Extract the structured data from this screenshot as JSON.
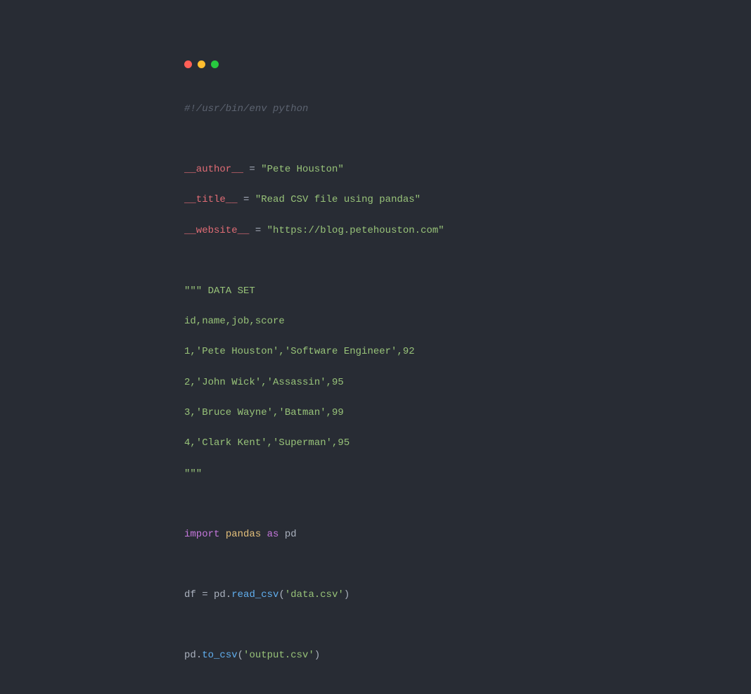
{
  "windowControls": {
    "closeColor": "#ff5f56",
    "minimizeColor": "#ffbd2e",
    "zoomColor": "#27c93f"
  },
  "code": {
    "shebang": "#!/usr/bin/env python",
    "authorKey": "__author__",
    "authorVal": "\"Pete Houston\"",
    "titleKey": "__title__",
    "titleVal": "\"Read CSV file using pandas\"",
    "websiteKey": "__website__",
    "websiteVal": "\"https://blog.petehouston.com\"",
    "eq": " = ",
    "docOpen": "\"\"\" DATA SET",
    "csvHeader": "id,name,job,score",
    "row1": "1,'Pete Houston','Software Engineer',92",
    "row2": "2,'John Wick','Assassin',95",
    "row3": "3,'Bruce Wayne','Batman',99",
    "row4": "4,'Clark Kent','Superman',95",
    "docClose": "\"\"\"",
    "importKw": "import",
    "importModule": " pandas ",
    "asKw": "as",
    "importAlias": " pd",
    "dfVar": "df",
    "eq2": " = ",
    "pdRef1": "pd",
    "dot": ".",
    "readCsv": "read_csv",
    "readArg": "'data.csv'",
    "pdRef2": "pd",
    "toCsv": "to_csv",
    "writeArg": "'output.csv'",
    "lp": "(",
    "rp": ")"
  }
}
